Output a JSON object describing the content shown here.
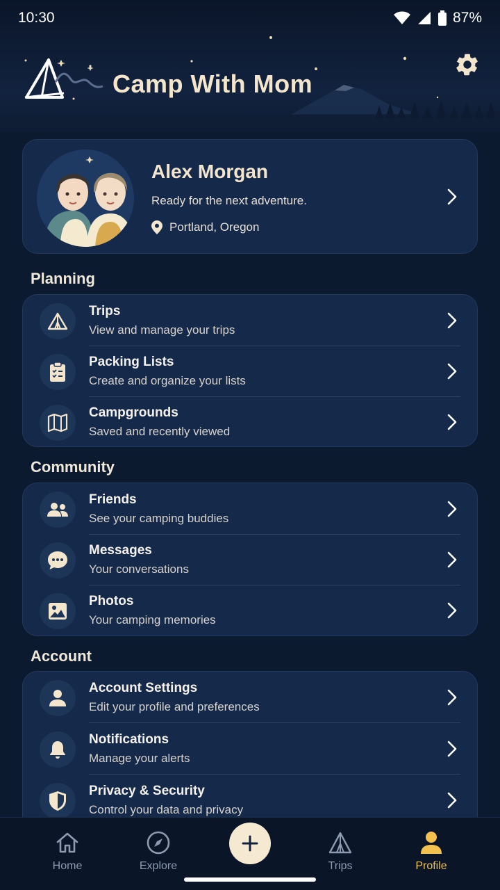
{
  "status_bar": {
    "time": "10:30",
    "battery": "87%"
  },
  "app": {
    "title": "Camp With Mom"
  },
  "profile": {
    "name": "Alex Morgan",
    "bio": "Ready for the next adventure.",
    "location": "Portland, Oregon"
  },
  "sections": {
    "planning": {
      "title": "Planning",
      "items": [
        {
          "title": "Trips",
          "subtitle": "View and manage your trips",
          "icon": "tent-icon"
        },
        {
          "title": "Packing Lists",
          "subtitle": "Create and organize your lists",
          "icon": "clipboard-checklist-icon"
        },
        {
          "title": "Campgrounds",
          "subtitle": "Saved and recently viewed",
          "icon": "map-icon"
        }
      ]
    },
    "community": {
      "title": "Community",
      "items": [
        {
          "title": "Friends",
          "subtitle": "See your camping buddies",
          "icon": "people-icon"
        },
        {
          "title": "Messages",
          "subtitle": "Your conversations",
          "icon": "chat-bubble-icon"
        },
        {
          "title": "Photos",
          "subtitle": "Your camping memories",
          "icon": "image-icon"
        }
      ]
    },
    "account": {
      "title": "Account",
      "items": [
        {
          "title": "Account Settings",
          "subtitle": "Edit your profile and preferences",
          "icon": "person-icon"
        },
        {
          "title": "Notifications",
          "subtitle": "Manage your alerts",
          "icon": "bell-icon"
        },
        {
          "title": "Privacy & Security",
          "subtitle": "Control your data and privacy",
          "icon": "shield-icon"
        }
      ]
    }
  },
  "bottom_nav": {
    "items": [
      {
        "label": "Home",
        "icon": "home-icon"
      },
      {
        "label": "Explore",
        "icon": "compass-icon"
      },
      {
        "label": "",
        "icon": "plus-icon"
      },
      {
        "label": "Trips",
        "icon": "tent-icon"
      },
      {
        "label": "Profile",
        "icon": "person-icon",
        "active": true
      }
    ]
  },
  "colors": {
    "background": "#0c1a30",
    "card": "#15294a",
    "accent": "#f2c14e",
    "title_cream": "#f3e6cc"
  }
}
